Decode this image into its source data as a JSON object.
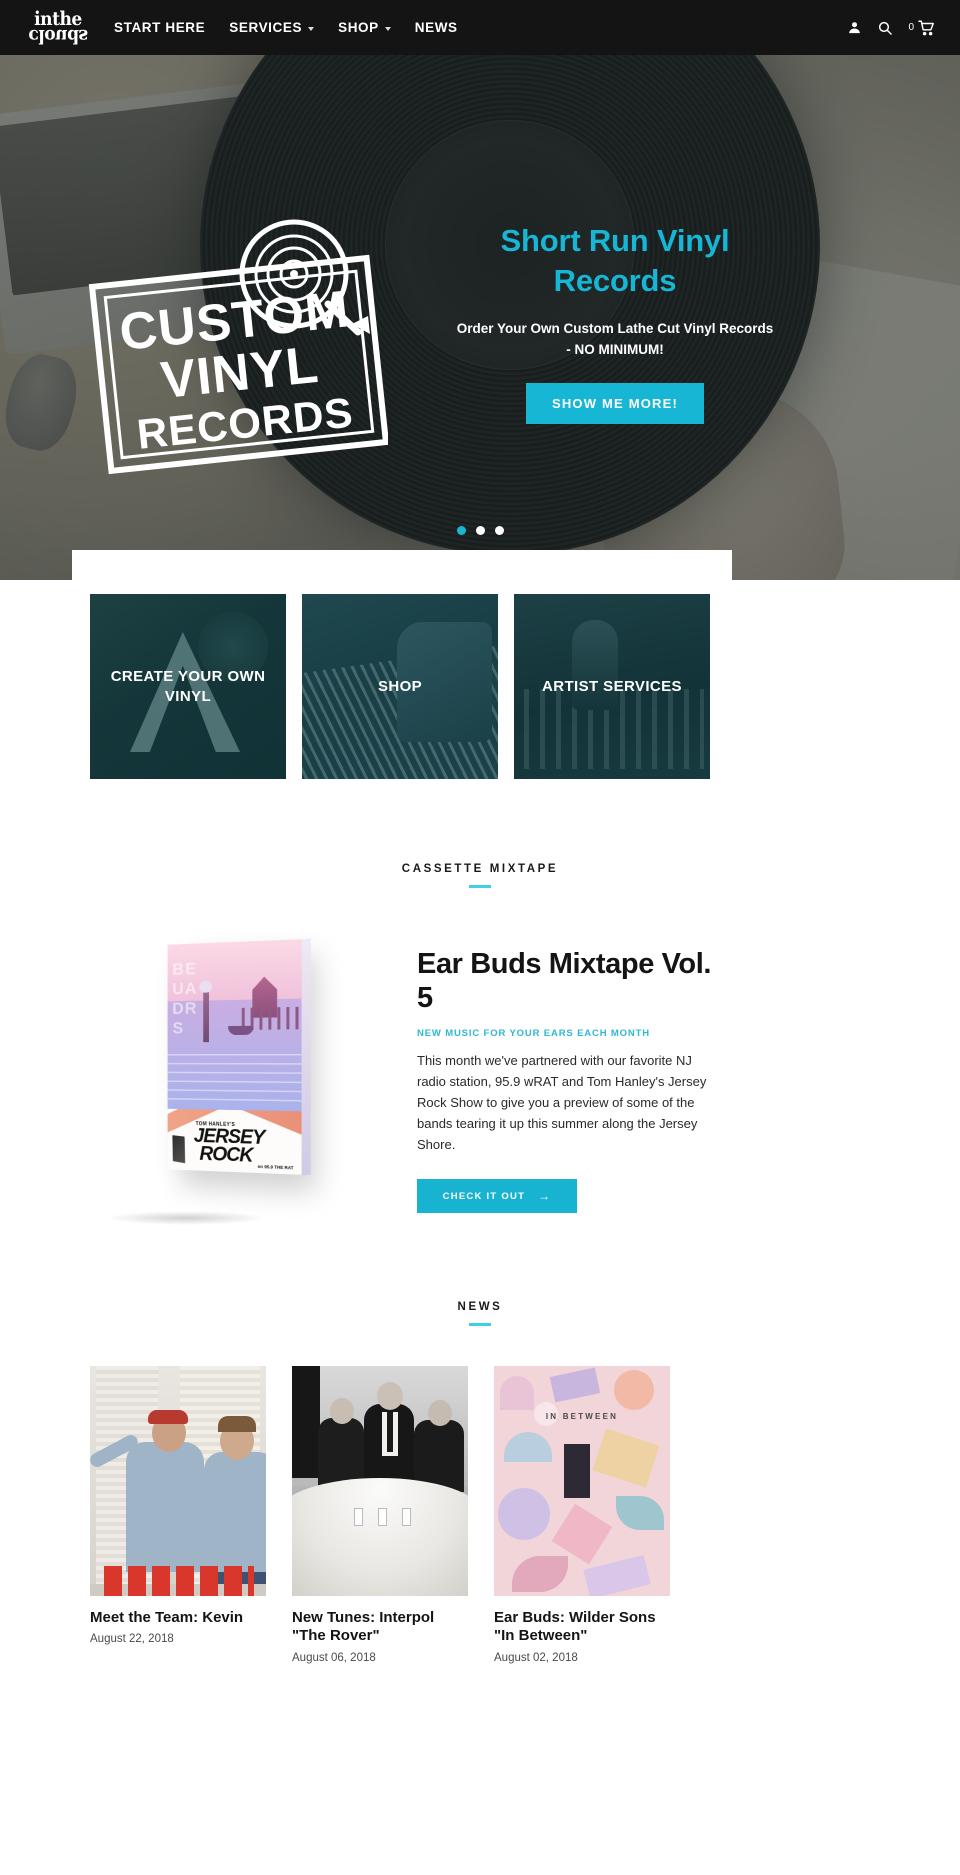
{
  "header": {
    "logo": {
      "line1": "inthe",
      "line2": "clouds",
      "alt": "In The Clouds logo"
    },
    "nav": [
      {
        "label": "START HERE",
        "has_dropdown": false
      },
      {
        "label": "SERVICES",
        "has_dropdown": true
      },
      {
        "label": "SHOP",
        "has_dropdown": true
      },
      {
        "label": "NEWS",
        "has_dropdown": false
      }
    ],
    "icons": {
      "account": "user-icon",
      "search": "search-icon",
      "cart": "cart-icon"
    },
    "cart_count": "0",
    "background": "#141414"
  },
  "hero": {
    "stamp_lines": [
      "CUSTOM",
      "VINYL",
      "RECORDS"
    ],
    "title": "Short Run Vinyl Records",
    "subtitle": "Order Your Own Custom Lathe Cut Vinyl Records - NO MINIMUM!",
    "button": "SHOW ME MORE!",
    "accent": "#16b6d4",
    "slides": [
      {
        "active": true
      },
      {
        "active": false
      },
      {
        "active": false
      }
    ]
  },
  "categories": [
    {
      "label": "CREATE YOUR OWN VINYL",
      "art": "art-lathe"
    },
    {
      "label": "SHOP",
      "art": "art-shop"
    },
    {
      "label": "ARTIST SERVICES",
      "art": "art-artist"
    }
  ],
  "mixtape": {
    "section_title": "CASSETTE MIXTAPE",
    "title": "Ear Buds Mixtape Vol. 5",
    "kicker": "NEW MUSIC FOR YOUR EARS EACH MONTH",
    "body": "This month we've partnered with our favorite NJ radio station, 95.9 wRAT and Tom Hanley's Jersey Rock Show to give you a preview of some of the bands tearing it up this summer along the Jersey Shore.",
    "button": "CHECK IT OUT",
    "button_arrow": "→",
    "cover": {
      "side_text": "EAR BUDS",
      "brand_small": "TOM HANLEY'S",
      "brand_line1": "JERSEY",
      "brand_line2": "ROCK",
      "brand_sub": "on 95.9 THE RAT"
    }
  },
  "news": {
    "section_title": "NEWS",
    "posts": [
      {
        "title": "Meet the Team: Kevin",
        "date": "August 22, 2018",
        "thumb": "th1"
      },
      {
        "title": "New Tunes: Interpol \"The Rover\"",
        "date": "August 06, 2018",
        "thumb": "th2"
      },
      {
        "title": "Ear Buds: Wilder Sons \"In Between\"",
        "date": "August 02, 2018",
        "thumb": "th3"
      }
    ]
  },
  "theme": {
    "accent_cyan": "#16b6d4",
    "rule_cyan": "#3fd0e6",
    "header_bg": "#141414",
    "text_dark": "#141414"
  }
}
